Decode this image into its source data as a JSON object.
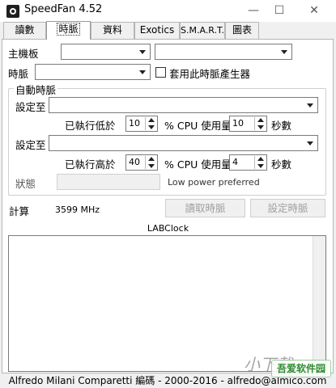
{
  "window": {
    "title": "SpeedFan 4.52",
    "controls": {
      "minimize": "—",
      "maximize": "☐",
      "close": "✕"
    }
  },
  "tabs": [
    {
      "label": "讀數"
    },
    {
      "label": "時脈",
      "active": true
    },
    {
      "label": "資料"
    },
    {
      "label": "Exotics"
    },
    {
      "label": "S.M.A.R.T."
    },
    {
      "label": "圖表"
    }
  ],
  "clock": {
    "motherboard_label": "主機板",
    "motherboard_value": "",
    "motherboard_value2": "",
    "clock_label": "時脈",
    "clock_value": "",
    "use_generator_label": "套用此時脈產生器",
    "use_generator_checked": false
  },
  "auto": {
    "group_title": "自動時脈",
    "set_to_label": "設定至",
    "low": {
      "value": "",
      "prefix": "已執行低於",
      "cpu_percent": "10",
      "middle": "% CPU 使用量",
      "seconds": "10",
      "suffix": "秒數"
    },
    "high": {
      "value": "",
      "prefix": "已執行高於",
      "cpu_percent": "40",
      "middle": "% CPU 使用量",
      "seconds": "4",
      "suffix": "秒數"
    },
    "status_label": "狀態",
    "status_value": "",
    "status_text": "Low power preferred"
  },
  "calc": {
    "label": "計算",
    "value": "3599 MHz",
    "read_button": "讀取時脈",
    "set_button": "設定時脈"
  },
  "labclock": {
    "title": "LABClock"
  },
  "footer": {
    "text": "Alfredo Milani Comparetti 編碼 - 2000-2016 - alfredo@almico.com"
  },
  "watermark": {
    "text": "小下载",
    "badge": "吾爱软件园"
  }
}
